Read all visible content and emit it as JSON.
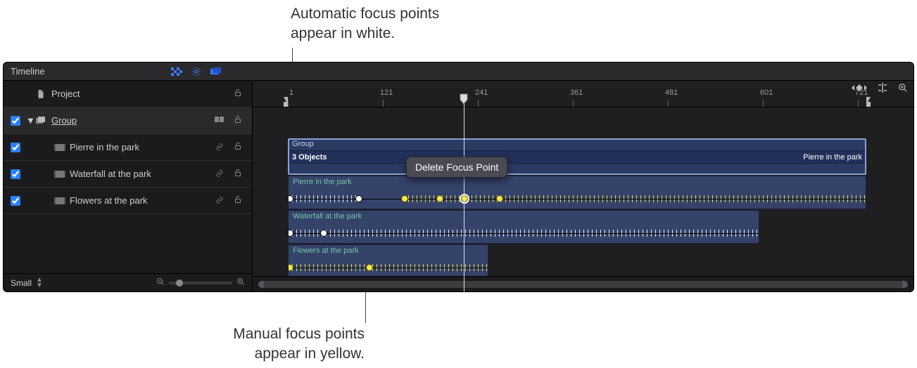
{
  "annotations": {
    "top": "Automatic focus points\nappear in white.",
    "bottom": "Manual focus points\nappear in yellow."
  },
  "toolbar": {
    "title": "Timeline"
  },
  "sidebar": {
    "items": [
      {
        "label": "Project",
        "type": "project"
      },
      {
        "label": "Group",
        "type": "group",
        "underline": true
      },
      {
        "label": "Pierre in the park",
        "type": "clip"
      },
      {
        "label": "Waterfall at the park",
        "type": "clip"
      },
      {
        "label": "Flowers at the park",
        "type": "clip"
      }
    ],
    "footer": {
      "sizeLabel": "Small"
    }
  },
  "ruler": {
    "ticks": [
      "1",
      "121",
      "241",
      "361",
      "481",
      "601",
      "721"
    ]
  },
  "group": {
    "header": "Group",
    "objects": "3 Objects",
    "mini": "Pierre in the park"
  },
  "clips": [
    {
      "title": "Pierre in the park"
    },
    {
      "title": "Waterfall at the park"
    },
    {
      "title": "Flowers at the park"
    }
  ],
  "contextMenu": {
    "item": "Delete Focus Point"
  }
}
